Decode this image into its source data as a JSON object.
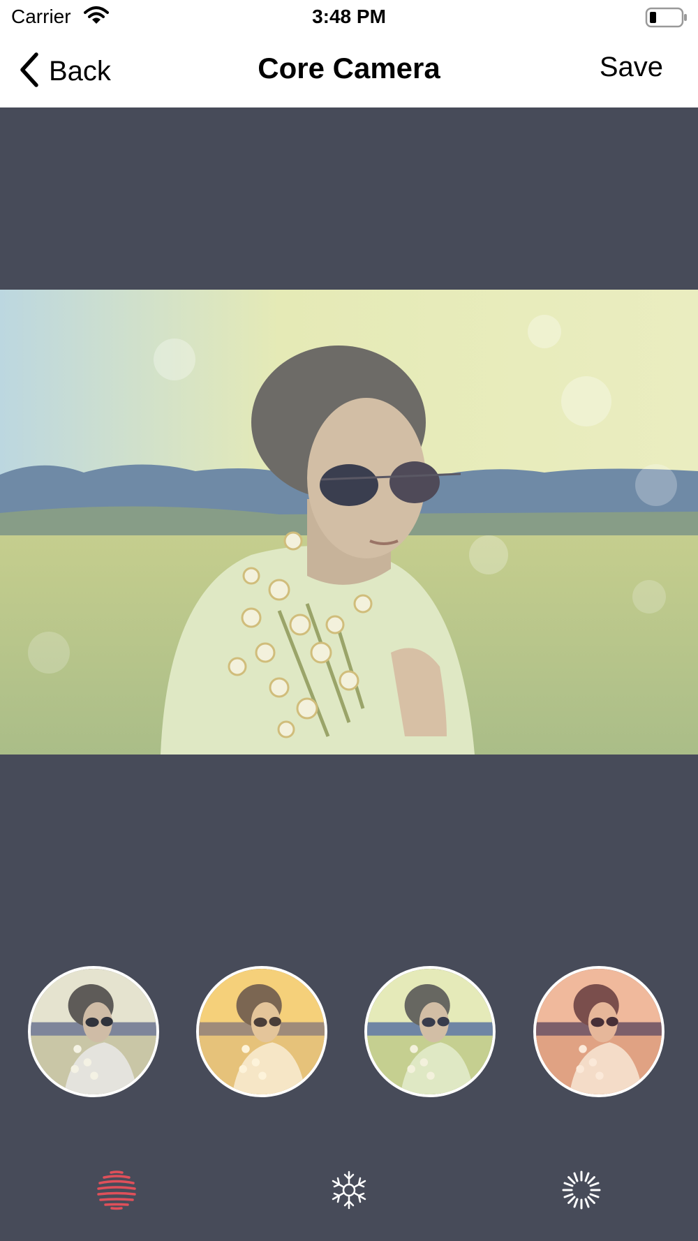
{
  "status_bar": {
    "carrier": "Carrier",
    "time": "3:48 PM"
  },
  "nav": {
    "back_label": "Back",
    "title": "Core Camera",
    "save_label": "Save"
  },
  "filters": [
    {
      "name": "filter-1"
    },
    {
      "name": "filter-2"
    },
    {
      "name": "filter-3"
    },
    {
      "name": "filter-4"
    }
  ],
  "toolbar": {
    "items": [
      {
        "icon": "striped-sphere-icon",
        "active": true
      },
      {
        "icon": "snowflake-icon",
        "active": false
      },
      {
        "icon": "starburst-icon",
        "active": false
      }
    ]
  },
  "colors": {
    "background": "#474b59",
    "accent": "#e0505a",
    "nav_background": "#ffffff"
  }
}
